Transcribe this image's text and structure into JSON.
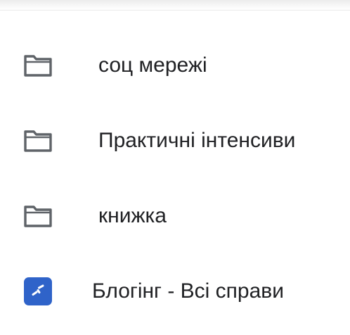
{
  "colors": {
    "folder_icon": "#5f6368",
    "app_tile": "#2f63c9",
    "text": "#202124"
  },
  "list": {
    "items": [
      {
        "icon": "folder-icon",
        "label": "соц мережі"
      },
      {
        "icon": "folder-icon",
        "label": "Практичні інтенсиви"
      },
      {
        "icon": "folder-icon",
        "label": "книжка"
      },
      {
        "icon": "app-tile-icon",
        "label": "Блогінг - Всі справи"
      }
    ]
  }
}
